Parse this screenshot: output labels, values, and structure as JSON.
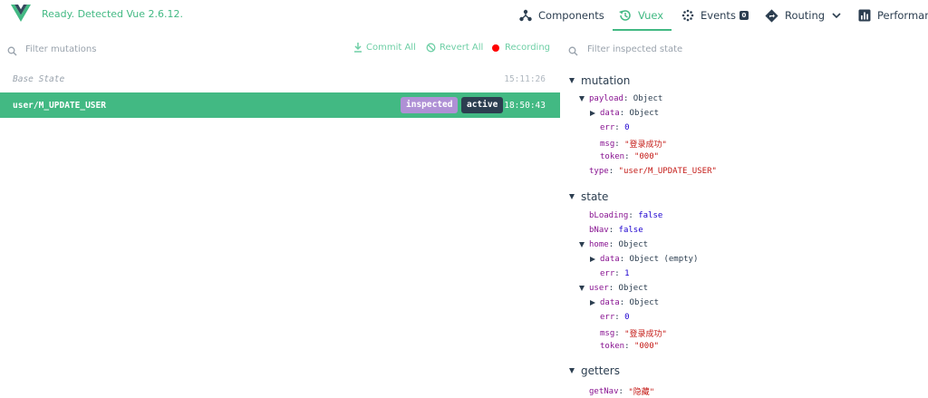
{
  "header": {
    "status": "Ready. Detected Vue 2.6.12.",
    "nav": {
      "components": "Components",
      "vuex": "Vuex",
      "events": "Events",
      "events_count": "0",
      "routing": "Routing",
      "performance": "Performan"
    },
    "colors": {
      "accent": "#42b983",
      "text": "#2c3e50",
      "inspected_tag": "#af90d5",
      "record": "#ff0000"
    }
  },
  "toolbar": {
    "filter_mutations_placeholder": "Filter mutations",
    "commit_all": "Commit All",
    "revert_all": "Revert All",
    "recording": "Recording",
    "filter_state_placeholder": "Filter inspected state"
  },
  "mutations": {
    "base": {
      "name": "Base State",
      "time": "15:11:26"
    },
    "selected": {
      "name": "user/M_UPDATE_USER",
      "inspected": "inspected",
      "active": "active",
      "time": "18:50:43"
    }
  },
  "inspector": {
    "mutation": {
      "title": "mutation",
      "payload_key": "payload",
      "payload_val": "Object",
      "data_key": "data",
      "data_val": "Object",
      "err_key": "err",
      "err_val": "0",
      "msg_key": "msg",
      "msg_val": "\"登录成功\"",
      "token_key": "token",
      "token_val": "\"000\"",
      "type_key": "type",
      "type_val": "\"user/M_UPDATE_USER\""
    },
    "state": {
      "title": "state",
      "bLoading_key": "bLoading",
      "bLoading_val": "false",
      "bNav_key": "bNav",
      "bNav_val": "false",
      "home_key": "home",
      "home_val": "Object",
      "home_data_key": "data",
      "home_data_val": "Object (empty)",
      "home_err_key": "err",
      "home_err_val": "1",
      "user_key": "user",
      "user_val": "Object",
      "user_data_key": "data",
      "user_data_val": "Object",
      "user_err_key": "err",
      "user_err_val": "0",
      "user_msg_key": "msg",
      "user_msg_val": "\"登录成功\"",
      "user_token_key": "token",
      "user_token_val": "\"000\""
    },
    "getters": {
      "title": "getters",
      "getNav_key": "getNav",
      "getNav_val": "\"隐藏\""
    }
  }
}
